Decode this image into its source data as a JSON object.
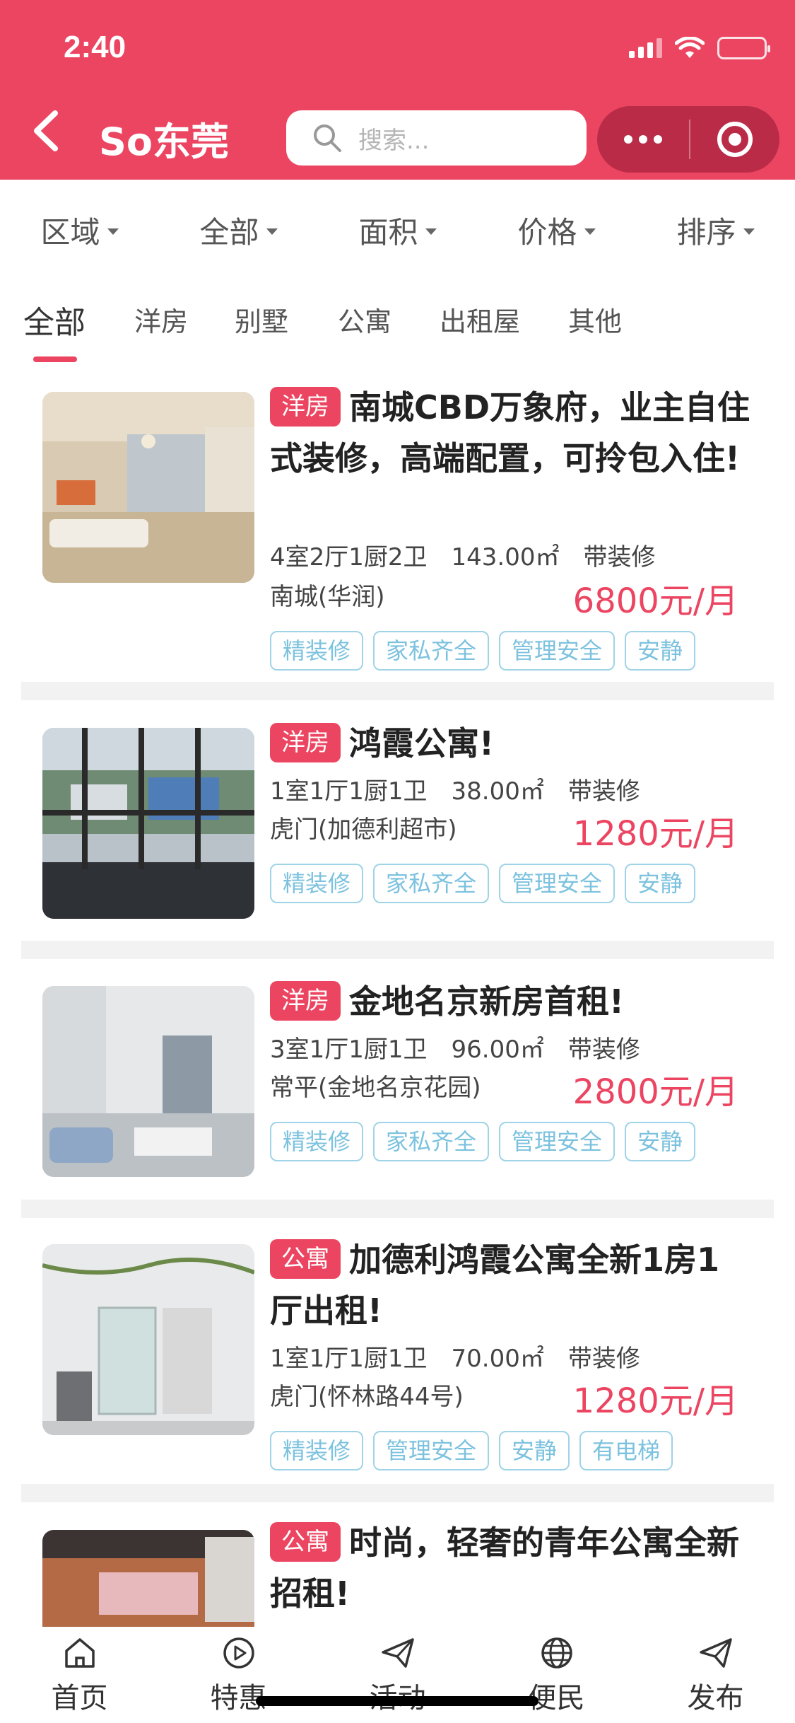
{
  "status_bar": {
    "time": "2:40"
  },
  "header": {
    "title": "So东莞",
    "search_placeholder": "搜索..."
  },
  "filters": [
    {
      "label": "区域"
    },
    {
      "label": "全部"
    },
    {
      "label": "面积"
    },
    {
      "label": "价格"
    },
    {
      "label": "排序"
    }
  ],
  "tabs": [
    {
      "label": "全部",
      "active": true
    },
    {
      "label": "洋房"
    },
    {
      "label": "别墅"
    },
    {
      "label": "公寓"
    },
    {
      "label": "出租屋"
    },
    {
      "label": "其他"
    }
  ],
  "listings": [
    {
      "badge": "洋房",
      "title": "南城CBD万象府，业主自住式装修，高端配置，可拎包入住!",
      "layout": "4室2厅1厨2卫",
      "area": "143.00㎡",
      "decor": "带装修",
      "location": "南城(华润)",
      "price": "6800元/月",
      "tags": [
        "精装修",
        "家私齐全",
        "管理安全",
        "安静"
      ]
    },
    {
      "badge": "洋房",
      "title": "鸿霞公寓!",
      "layout": "1室1厅1厨1卫",
      "area": "38.00㎡",
      "decor": "带装修",
      "location": "虎门(加德利超市)",
      "price": "1280元/月",
      "tags": [
        "精装修",
        "家私齐全",
        "管理安全",
        "安静"
      ]
    },
    {
      "badge": "洋房",
      "title": "金地名京新房首租!",
      "layout": "3室1厅1厨1卫",
      "area": "96.00㎡",
      "decor": "带装修",
      "location": "常平(金地名京花园)",
      "price": "2800元/月",
      "tags": [
        "精装修",
        "家私齐全",
        "管理安全",
        "安静"
      ]
    },
    {
      "badge": "公寓",
      "title": "加德利鸿霞公寓全新1房1厅出租!",
      "layout": "1室1厅1厨1卫",
      "area": "70.00㎡",
      "decor": "带装修",
      "location": "虎门(怀林路44号)",
      "price": "1280元/月",
      "tags": [
        "精装修",
        "管理安全",
        "安静",
        "有电梯"
      ]
    },
    {
      "badge": "公寓",
      "title": "时尚，轻奢的青年公寓全新招租!"
    }
  ],
  "bottom_nav": [
    {
      "label": "首页",
      "icon": "home-icon"
    },
    {
      "label": "特惠",
      "icon": "play-circle-icon"
    },
    {
      "label": "活动",
      "icon": "send-icon"
    },
    {
      "label": "便民",
      "icon": "globe-icon"
    },
    {
      "label": "发布",
      "icon": "send-icon"
    }
  ],
  "colors": {
    "accent": "#ec4561",
    "tag": "#7cc2de",
    "capsule": "#b92b47"
  }
}
